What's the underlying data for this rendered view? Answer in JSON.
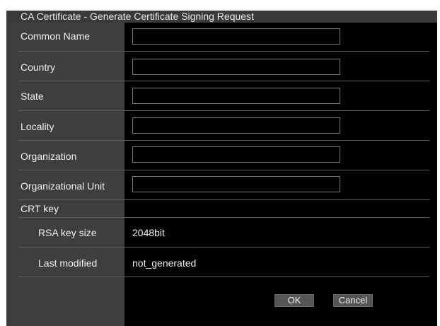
{
  "dialog": {
    "title": "CA Certificate - Generate Certificate Signing Request"
  },
  "fields": [
    {
      "label": "Common Name",
      "value": "",
      "placeholder": ""
    },
    {
      "label": "Country",
      "value": "",
      "placeholder": ""
    },
    {
      "label": "State",
      "value": "",
      "placeholder": ""
    },
    {
      "label": "Locality",
      "value": "",
      "placeholder": ""
    },
    {
      "label": "Organization",
      "value": "",
      "placeholder": ""
    },
    {
      "label": "Organizational Unit",
      "value": "",
      "placeholder": ""
    }
  ],
  "crt_key": {
    "section_label": "CRT key",
    "rsa_label": "RSA key size",
    "rsa_value": "2048bit",
    "modified_label": "Last modified",
    "modified_value": "not_generated"
  },
  "buttons": {
    "ok": "OK",
    "cancel": "Cancel"
  },
  "colors": {
    "background": "#000000",
    "label_column": "#3e3e3e",
    "title_bar": "#3a3a3a",
    "button": "#555555",
    "text": "#f0f0f0"
  }
}
